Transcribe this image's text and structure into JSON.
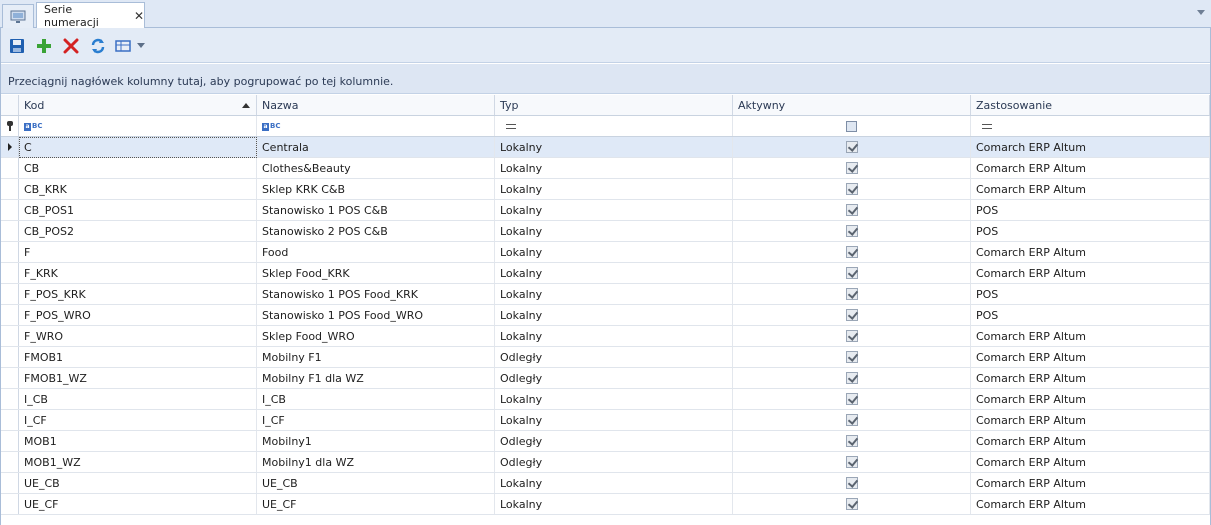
{
  "tabs": {
    "active_label": "Serie numeracji",
    "close_glyph": "✕"
  },
  "toolbar": {
    "buttons": [
      {
        "name": "save",
        "icon": "floppy-disk-icon",
        "color": "#1f5fb0"
      },
      {
        "name": "add",
        "icon": "plus-icon",
        "color": "#3aa336"
      },
      {
        "name": "delete",
        "icon": "x-icon",
        "color": "#d42222"
      },
      {
        "name": "refresh",
        "icon": "refresh-icon",
        "color": "#2a7ed0"
      },
      {
        "name": "view",
        "icon": "grid-view-icon",
        "color": "#3b6fc4"
      }
    ]
  },
  "group_panel": {
    "text": "Przeciągnij nagłówek kolumny tutaj, aby pogrupować po tej kolumnie."
  },
  "grid": {
    "columns": [
      "Kod",
      "Nazwa",
      "Typ",
      "Aktywny",
      "Zastosowanie"
    ],
    "sorted_column": "Kod",
    "sort_direction": "asc",
    "rows": [
      {
        "kod": "C",
        "nazwa": "Centrala",
        "typ": "Lokalny",
        "aktywny": true,
        "zastosowanie": "Comarch ERP Altum",
        "selected": true
      },
      {
        "kod": "CB",
        "nazwa": "Clothes&Beauty",
        "typ": "Lokalny",
        "aktywny": true,
        "zastosowanie": "Comarch ERP Altum"
      },
      {
        "kod": "CB_KRK",
        "nazwa": "Sklep KRK C&B",
        "typ": "Lokalny",
        "aktywny": true,
        "zastosowanie": "Comarch ERP Altum"
      },
      {
        "kod": "CB_POS1",
        "nazwa": "Stanowisko 1 POS C&B",
        "typ": "Lokalny",
        "aktywny": true,
        "zastosowanie": "POS"
      },
      {
        "kod": "CB_POS2",
        "nazwa": "Stanowisko 2 POS C&B",
        "typ": "Lokalny",
        "aktywny": true,
        "zastosowanie": "POS"
      },
      {
        "kod": "F",
        "nazwa": "Food",
        "typ": "Lokalny",
        "aktywny": true,
        "zastosowanie": "Comarch ERP Altum"
      },
      {
        "kod": "F_KRK",
        "nazwa": "Sklep Food_KRK",
        "typ": "Lokalny",
        "aktywny": true,
        "zastosowanie": "Comarch ERP Altum"
      },
      {
        "kod": "F_POS_KRK",
        "nazwa": "Stanowisko 1 POS Food_KRK",
        "typ": "Lokalny",
        "aktywny": true,
        "zastosowanie": "POS"
      },
      {
        "kod": "F_POS_WRO",
        "nazwa": "Stanowisko 1 POS Food_WRO",
        "typ": "Lokalny",
        "aktywny": true,
        "zastosowanie": "POS"
      },
      {
        "kod": "F_WRO",
        "nazwa": "Sklep Food_WRO",
        "typ": "Lokalny",
        "aktywny": true,
        "zastosowanie": "Comarch ERP Altum"
      },
      {
        "kod": "FMOB1",
        "nazwa": "Mobilny F1",
        "typ": "Odległy",
        "aktywny": true,
        "zastosowanie": "Comarch ERP Altum"
      },
      {
        "kod": "FMOB1_WZ",
        "nazwa": "Mobilny F1 dla WZ",
        "typ": "Odległy",
        "aktywny": true,
        "zastosowanie": "Comarch ERP Altum"
      },
      {
        "kod": "I_CB",
        "nazwa": "I_CB",
        "typ": "Lokalny",
        "aktywny": true,
        "zastosowanie": "Comarch ERP Altum"
      },
      {
        "kod": "I_CF",
        "nazwa": "I_CF",
        "typ": "Lokalny",
        "aktywny": true,
        "zastosowanie": "Comarch ERP Altum"
      },
      {
        "kod": "MOB1",
        "nazwa": "Mobilny1",
        "typ": "Odległy",
        "aktywny": true,
        "zastosowanie": "Comarch ERP Altum"
      },
      {
        "kod": "MOB1_WZ",
        "nazwa": "Mobilny1 dla WZ",
        "typ": "Odległy",
        "aktywny": true,
        "zastosowanie": "Comarch ERP Altum"
      },
      {
        "kod": "UE_CB",
        "nazwa": "UE_CB",
        "typ": "Lokalny",
        "aktywny": true,
        "zastosowanie": "Comarch ERP Altum"
      },
      {
        "kod": "UE_CF",
        "nazwa": "UE_CF",
        "typ": "Lokalny",
        "aktywny": true,
        "zastosowanie": "Comarch ERP Altum"
      }
    ]
  }
}
